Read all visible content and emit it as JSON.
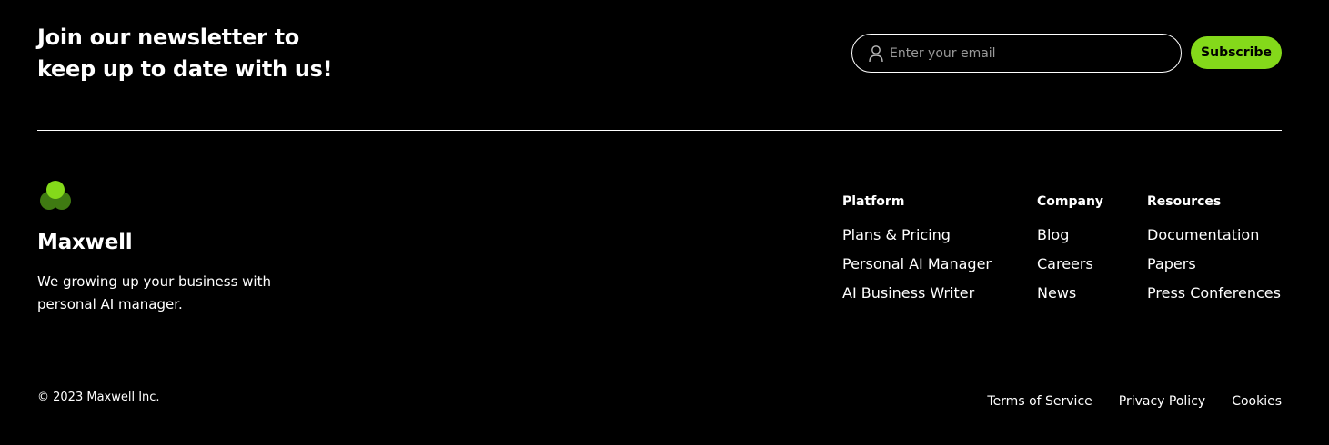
{
  "newsletter": {
    "title_line1": "Join our newsletter to",
    "title_line2": "keep up to date with us!",
    "email_placeholder": "Enter your email",
    "email_value": "",
    "subscribe_label": "Subscribe",
    "user_icon": "user-icon",
    "accent_color": "#84d91a"
  },
  "brand": {
    "name": "Maxwell",
    "description_line1": "We growing up your business with",
    "description_line2": "personal AI manager.",
    "logo_icon": "maxwell-logo"
  },
  "footer_columns": [
    {
      "title": "Platform",
      "links": [
        "Plans & Pricing",
        "Personal AI Manager",
        "AI Business Writer"
      ]
    },
    {
      "title": "Company",
      "links": [
        "Blog",
        "Careers",
        "News"
      ]
    },
    {
      "title": "Resources",
      "links": [
        "Documentation",
        "Papers",
        "Press Conferences"
      ]
    }
  ],
  "bottom": {
    "copyright": "© 2023 Maxwell Inc.",
    "legal_links": [
      "Terms of Service",
      "Privacy Policy",
      "Cookies"
    ]
  }
}
